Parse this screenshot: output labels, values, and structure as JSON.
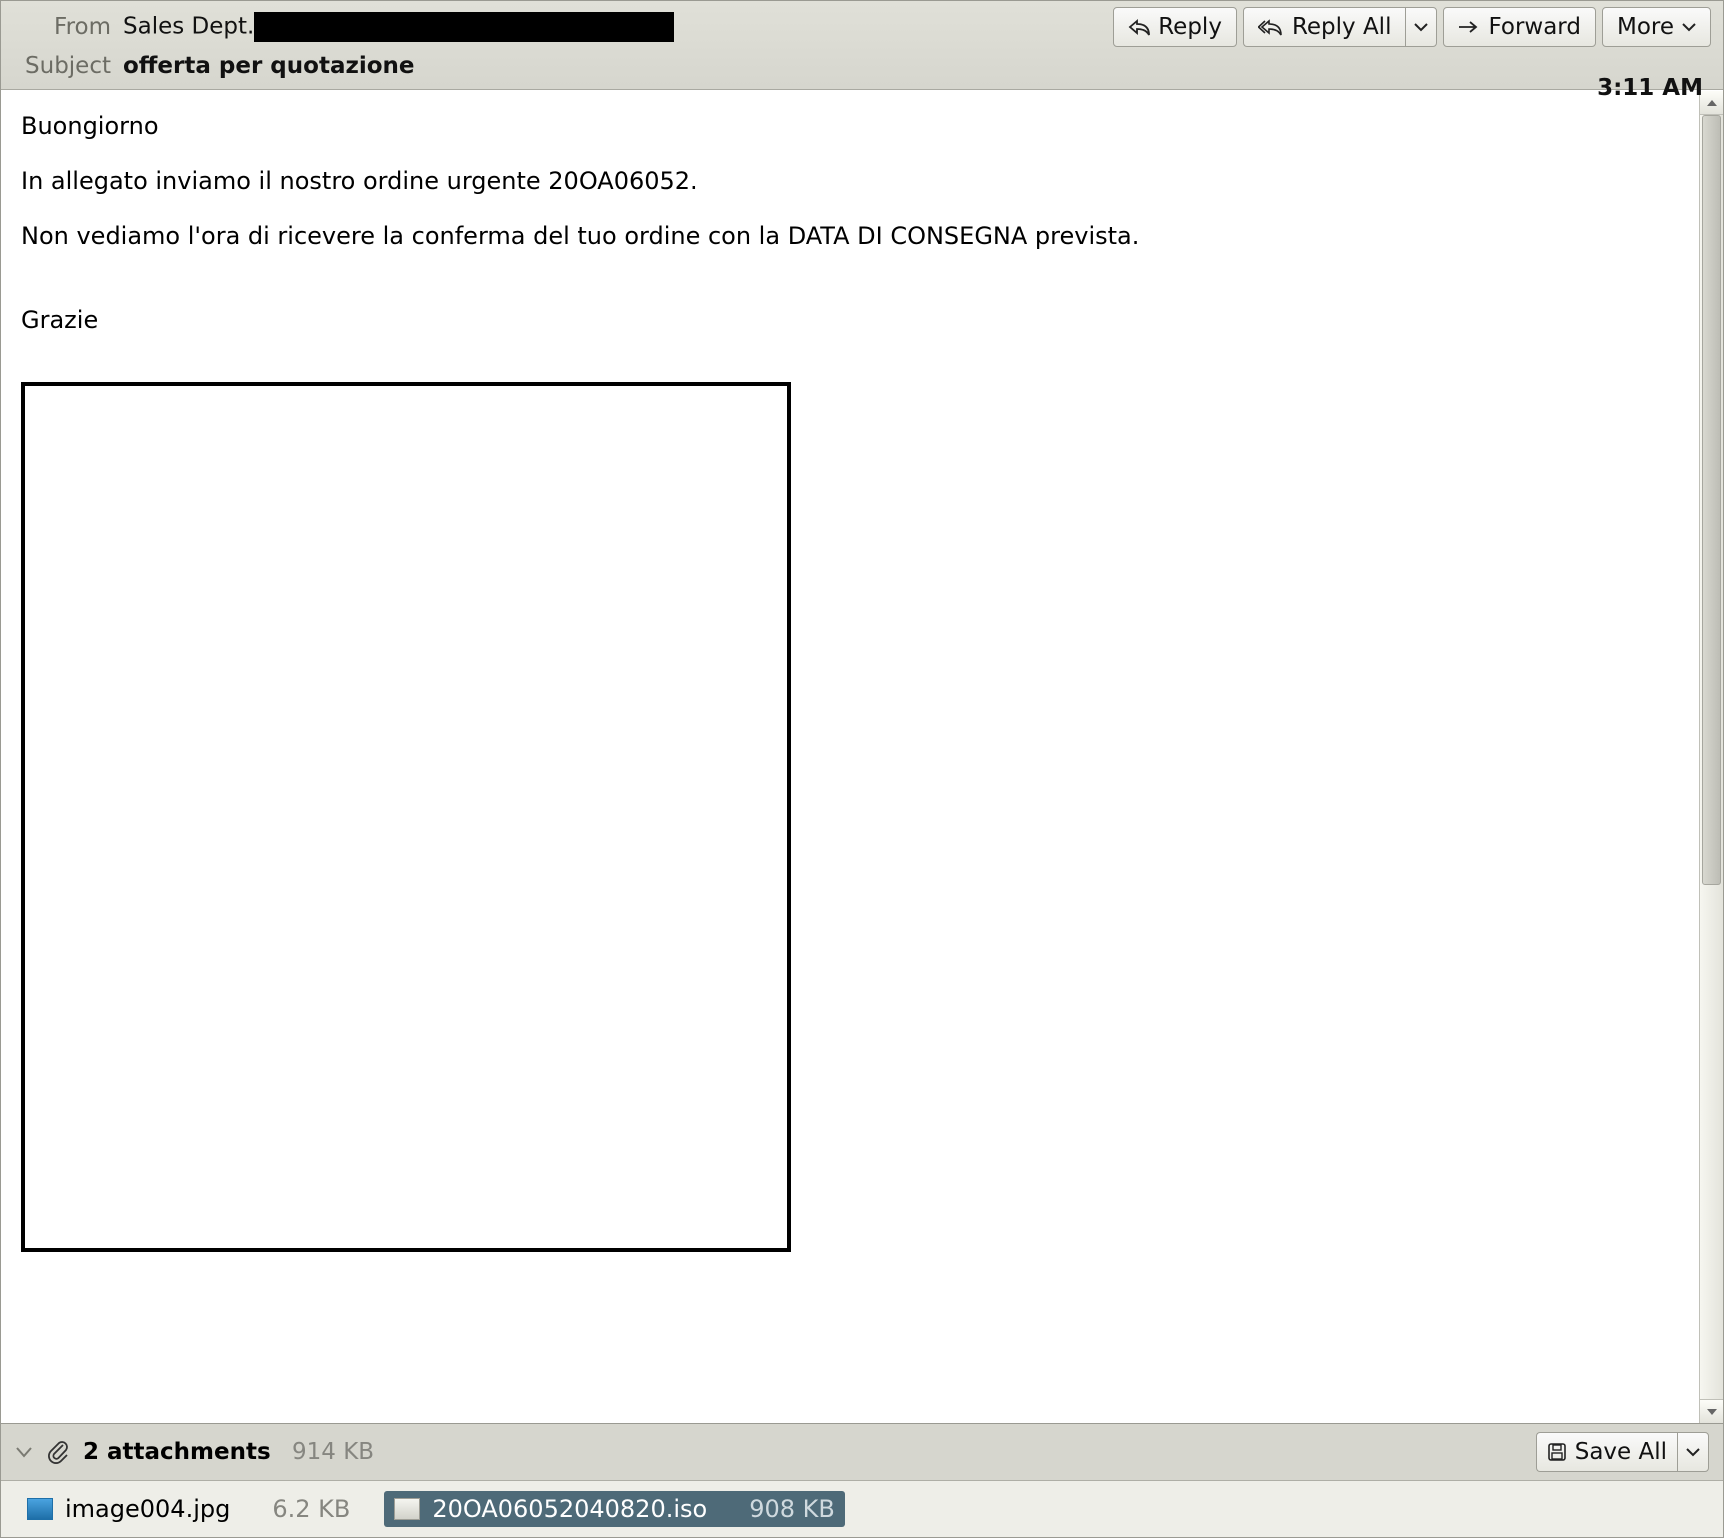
{
  "header": {
    "from_label": "From",
    "from_name": "Sales Dept.",
    "subject_label": "Subject",
    "subject": "offerta per quotazione",
    "time": "3:11 AM"
  },
  "toolbar": {
    "reply": "Reply",
    "reply_all": "Reply All",
    "forward": "Forward",
    "more": "More"
  },
  "body": {
    "p1": "Buongiorno",
    "p2": "In allegato inviamo il nostro ordine urgente 20OA06052.",
    "p3": "Non vediamo l'ora di ricevere la conferma del tuo ordine con la DATA DI CONSEGNA prevista.",
    "p4": "Grazie"
  },
  "attachments": {
    "count_label": "2 attachments",
    "total_size": "914 KB",
    "save_all": "Save All",
    "items": [
      {
        "name": "image004.jpg",
        "size": "6.2 KB",
        "icon": "jpg",
        "selected": false
      },
      {
        "name": "20OA06052040820.iso",
        "size": "908 KB",
        "icon": "generic",
        "selected": true
      }
    ]
  }
}
